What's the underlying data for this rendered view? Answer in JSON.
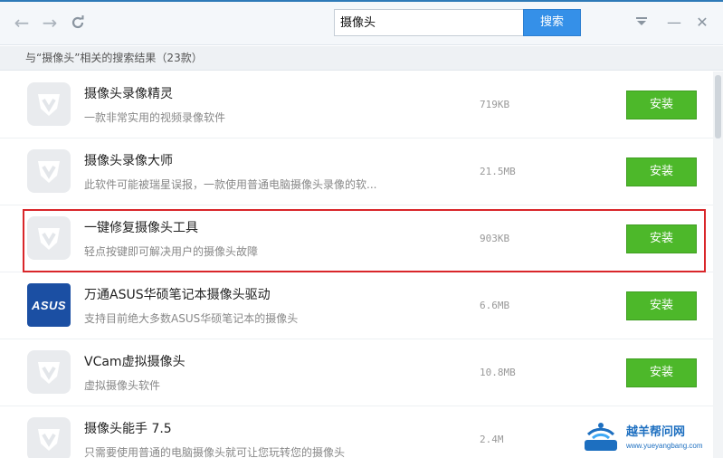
{
  "toolbar": {
    "back_icon": "arrow-left-icon",
    "forward_icon": "arrow-right-icon",
    "refresh_icon": "refresh-icon",
    "search_value": "摄像头",
    "search_button": "搜索",
    "dropdown_icon": "menu-dropdown-icon",
    "minimize_icon": "minimize-icon",
    "close_icon": "close-icon"
  },
  "summary": "与“摄像头”相关的搜索结果（23款）",
  "install_label": "安装",
  "colors": {
    "accent_blue": "#3590e8",
    "install_green": "#4db82a",
    "highlight_red": "#d9262a"
  },
  "results": [
    {
      "title": "摄像头录像精灵",
      "desc": "一款非常实用的视频录像软件",
      "size": "719KB",
      "icon": "shield-icon"
    },
    {
      "title": "摄像头录像大师",
      "desc": "此软件可能被瑞星误报，一款使用普通电脑摄像头录像的软...",
      "size": "21.5MB",
      "icon": "shield-icon"
    },
    {
      "title": "一键修复摄像头工具",
      "desc": "轻点按键即可解决用户的摄像头故障",
      "size": "903KB",
      "icon": "shield-icon"
    },
    {
      "title": "万通ASUS华硕笔记本摄像头驱动",
      "desc": "支持目前绝大多数ASUS华硕笔记本的摄像头",
      "size": "6.6MB",
      "icon": "asus-logo-icon",
      "logo_text": "ASUS"
    },
    {
      "title": "VCam虚拟摄像头",
      "desc": "虚拟摄像头软件",
      "size": "10.8MB",
      "icon": "shield-icon"
    },
    {
      "title": "摄像头能手 7.5",
      "desc": "只需要使用普通的电脑摄像头就可让您玩转您的摄像头",
      "size": "2.4M",
      "icon": "shield-icon"
    }
  ],
  "watermark": {
    "name": "越羊帮问网",
    "url": "www.yueyangbang.com"
  }
}
